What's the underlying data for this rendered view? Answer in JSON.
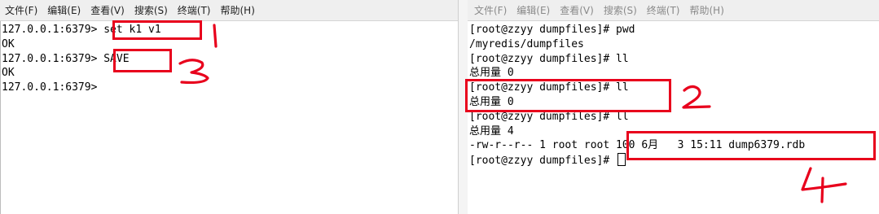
{
  "left_terminal": {
    "menu": [
      "文件(F)",
      "编辑(E)",
      "查看(V)",
      "搜索(S)",
      "终端(T)",
      "帮助(H)"
    ],
    "lines": [
      "127.0.0.1:6379> set k1 v1",
      "OK",
      "127.0.0.1:6379> SAVE",
      "OK",
      "127.0.0.1:6379>"
    ]
  },
  "right_terminal": {
    "menu": [
      "文件(F)",
      "编辑(E)",
      "查看(V)",
      "搜索(S)",
      "终端(T)",
      "帮助(H)"
    ],
    "top_clipped": "总用量 0",
    "lines": [
      "[root@zzyy dumpfiles]# pwd",
      "/myredis/dumpfiles",
      "[root@zzyy dumpfiles]# ll",
      "总用量 0",
      "[root@zzyy dumpfiles]# ll",
      "总用量 0",
      "[root@zzyy dumpfiles]# ll",
      "总用量 4",
      "-rw-r--r-- 1 root root 100 6月   3 15:11 dump6379.rdb",
      "[root@zzyy dumpfiles]# "
    ]
  },
  "annotations": {
    "color": "#e8001c",
    "marks": [
      "1",
      "2",
      "3",
      "4"
    ]
  }
}
